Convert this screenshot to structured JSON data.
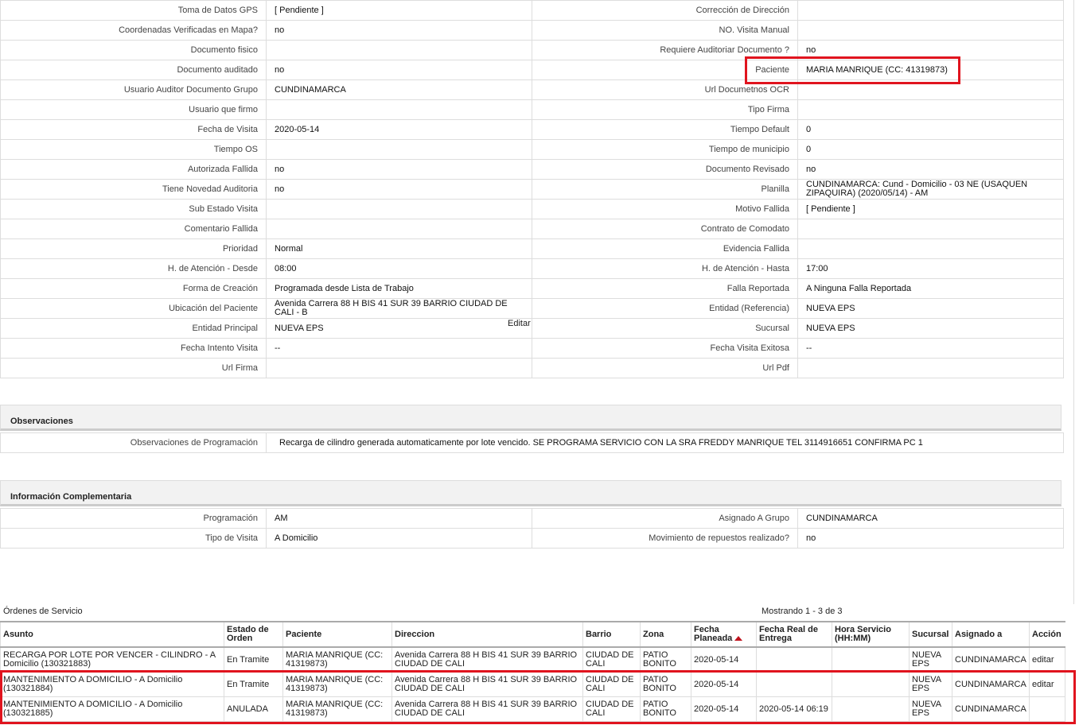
{
  "details": {
    "rows": [
      {
        "l1": "Toma de Datos GPS",
        "v1": "[ Pendiente ]",
        "l2": "Corrección de Dirección",
        "v2": ""
      },
      {
        "l1": "Coordenadas Verificadas en Mapa?",
        "v1": "no",
        "l2": "NO. Visita Manual",
        "v2": ""
      },
      {
        "l1": "Documento fisico",
        "v1": "",
        "l2": "Requiere Auditoriar Documento ?",
        "v2": "no"
      },
      {
        "l1": "Documento auditado",
        "v1": "no",
        "l2": "Paciente",
        "v2": "MARIA MANRIQUE (CC: 41319873)"
      },
      {
        "l1": "Usuario Auditor Documento Grupo",
        "v1": "CUNDINAMARCA",
        "l2": "Url Documetnos OCR",
        "v2": ""
      },
      {
        "l1": "Usuario que firmo",
        "v1": "",
        "l2": "Tipo Firma",
        "v2": ""
      },
      {
        "l1": "Fecha de Visita",
        "v1": "2020-05-14",
        "l2": "Tiempo Default",
        "v2": "0"
      },
      {
        "l1": "Tiempo OS",
        "v1": "",
        "l2": "Tiempo de municipio",
        "v2": "0"
      },
      {
        "l1": "Autorizada Fallida",
        "v1": "no",
        "l2": "Documento Revisado",
        "v2": "no"
      },
      {
        "l1": "Tiene Novedad Auditoria",
        "v1": "no",
        "l2": "Planilla",
        "v2": "CUNDINAMARCA: Cund - Domicilio - 03 NE (USAQUEN ZIPAQUIRA) (2020/05/14) - AM"
      },
      {
        "l1": "Sub Estado Visita",
        "v1": "",
        "l2": "Motivo Fallida",
        "v2": "[ Pendiente ]"
      },
      {
        "l1": "Comentario Fallida",
        "v1": "",
        "l2": "Contrato de Comodato",
        "v2": ""
      },
      {
        "l1": "Prioridad",
        "v1": "Normal",
        "l2": "Evidencia Fallida",
        "v2": ""
      },
      {
        "l1": "H. de Atención - Desde",
        "v1": "08:00",
        "l2": "H. de Atención - Hasta",
        "v2": "17:00"
      },
      {
        "l1": "Forma de Creación",
        "v1": "Programada desde Lista de Trabajo",
        "l2": "Falla Reportada",
        "v2": "A Ninguna Falla Reportada"
      },
      {
        "l1": "Ubicación del Paciente",
        "v1": "Avenida Carrera 88 H BIS 41 SUR 39 BARRIO CIUDAD DE CALI - B",
        "l2": "Entidad (Referencia)",
        "v2": "NUEVA EPS"
      },
      {
        "l1": "Entidad Principal",
        "v1": "NUEVA EPS",
        "l2": "Sucursal",
        "v2": "NUEVA EPS"
      },
      {
        "l1": "Fecha Intento Visita",
        "v1": "--",
        "l2": "Fecha Visita Exitosa",
        "v2": "--"
      },
      {
        "l1": "Url Firma",
        "v1": "",
        "l2": "Url Pdf",
        "v2": ""
      }
    ],
    "editar_label": "Editar"
  },
  "observaciones": {
    "title": "Observaciones",
    "label": "Observaciones de Programación",
    "value": "Recarga de cilindro generada automaticamente por lote vencido. SE PROGRAMA SERVICIO CON LA SRA FREDDY MANRIQUE TEL 3114916651 CONFIRMA PC 1"
  },
  "complementaria": {
    "title": "Información Complementaria",
    "rows": [
      {
        "l1": "Programación",
        "v1": "AM",
        "l2": "Asignado A Grupo",
        "v2": "CUNDINAMARCA"
      },
      {
        "l1": "Tipo de Visita",
        "v1": "A Domicilio",
        "l2": "Movimiento de repuestos realizado?",
        "v2": "no"
      }
    ]
  },
  "ordenes": {
    "title": "Órdenes de Servicio",
    "showing": "Mostrando 1 - 3 de 3",
    "sort_icon": "sort-asc-icon",
    "columns": [
      "Asunto",
      "Estado de Orden",
      "Paciente",
      "Direccion",
      "Barrio",
      "Zona",
      "Fecha Planeada",
      "Fecha Real de Entrega",
      "Hora Servicio (HH:MM)",
      "Sucursal",
      "Asignado a",
      "Acción"
    ],
    "rows": [
      {
        "asunto": "RECARGA POR LOTE POR VENCER - CILINDRO - A Domicilio (130321883)",
        "estado": "En Tramite",
        "paciente": "MARIA MANRIQUE (CC: 41319873)",
        "direccion": "Avenida Carrera 88 H BIS 41 SUR 39 BARRIO CIUDAD DE CALI",
        "barrio": "CIUDAD DE CALI",
        "zona": "PATIO BONITO",
        "fecha_planeada": "2020-05-14",
        "fecha_real": "",
        "hora": "",
        "sucursal": "NUEVA EPS",
        "asignado": "CUNDINAMARCA",
        "accion": "editar"
      },
      {
        "asunto": "MANTENIMIENTO A DOMICILIO - A Domicilio (130321884)",
        "estado": "En Tramite",
        "paciente": "MARIA MANRIQUE (CC: 41319873)",
        "direccion": "Avenida Carrera 88 H BIS 41 SUR 39 BARRIO CIUDAD DE CALI",
        "barrio": "CIUDAD DE CALI",
        "zona": "PATIO BONITO",
        "fecha_planeada": "2020-05-14",
        "fecha_real": "",
        "hora": "",
        "sucursal": "NUEVA EPS",
        "asignado": "CUNDINAMARCA",
        "accion": "editar"
      },
      {
        "asunto": "MANTENIMIENTO A DOMICILIO - A Domicilio (130321885)",
        "estado": "ANULADA",
        "paciente": "MARIA MANRIQUE (CC: 41319873)",
        "direccion": "Avenida Carrera 88 H BIS 41 SUR 39 BARRIO CIUDAD DE CALI",
        "barrio": "CIUDAD DE CALI",
        "zona": "PATIO BONITO",
        "fecha_planeada": "2020-05-14",
        "fecha_real": "2020-05-14 06:19",
        "hora": "",
        "sucursal": "NUEVA EPS",
        "asignado": "CUNDINAMARCA",
        "accion": ""
      }
    ]
  },
  "colors": {
    "highlight": "#e0141e",
    "sort_arrow": "#c0141e"
  }
}
